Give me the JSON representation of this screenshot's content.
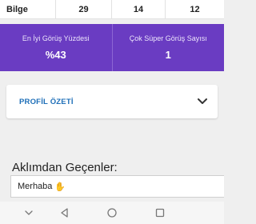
{
  "stats_row": {
    "label": "Bilge",
    "values": [
      "29",
      "14",
      "12"
    ]
  },
  "metrics": [
    {
      "label": "En İyi Görüş Yüzdesi",
      "value": "%43"
    },
    {
      "label": "Çok Süper Görüş Sayısı",
      "value": "1"
    }
  ],
  "profile_summary": {
    "title": "PROFİL ÖZETİ"
  },
  "thoughts": {
    "heading": "Aklımdan Geçenler:",
    "message": "Merhaba",
    "emoji_icon": "waving-hand-icon"
  },
  "nav": {
    "icons": [
      "chevron-down-icon",
      "back-triangle-icon",
      "home-circle-icon",
      "recents-square-icon"
    ]
  },
  "colors": {
    "accent_purple": "#6a3cc2",
    "link_blue": "#1e6fb8",
    "background": "#efefef"
  }
}
